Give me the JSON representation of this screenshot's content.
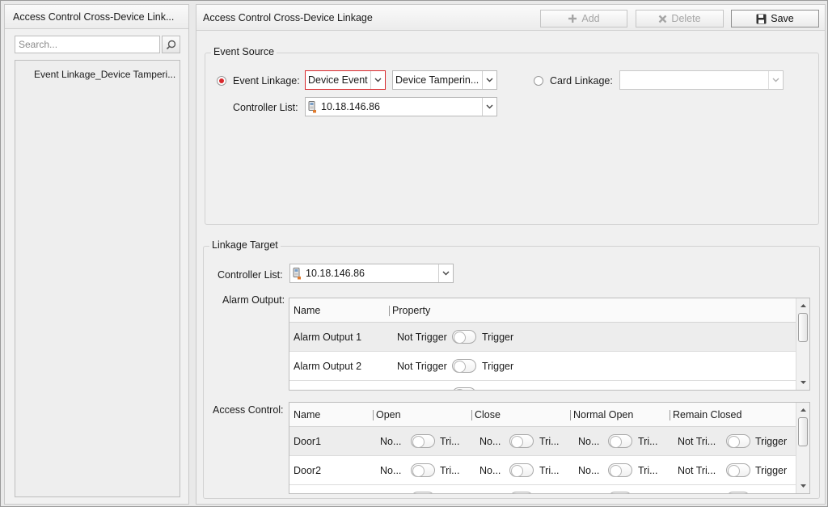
{
  "left_panel": {
    "title": "Access Control Cross-Device Link...",
    "search": {
      "placeholder": "Search...",
      "value": ""
    },
    "tree_items": [
      {
        "label": "Event Linkage_Device Tamperi..."
      }
    ]
  },
  "right_panel": {
    "title": "Access Control Cross-Device Linkage",
    "toolbar": {
      "add_label": "Add",
      "delete_label": "Delete",
      "save_label": "Save"
    },
    "event_source": {
      "title": "Event Source",
      "event_linkage_label": "Event Linkage:",
      "event_type_value": "Device Event",
      "event_value": "Device Tamperin...",
      "card_linkage_label": "Card Linkage:",
      "card_linkage_value": "",
      "controller_list_label": "Controller List:",
      "controller_value": "10.18.146.86"
    },
    "linkage_target": {
      "title": "Linkage Target",
      "controller_list_label": "Controller List:",
      "controller_value": "10.18.146.86",
      "alarm_output": {
        "label": "Alarm Output:",
        "columns": [
          "Name",
          "Property"
        ],
        "rows": [
          {
            "name": "Alarm Output 1",
            "off": "Not Trigger",
            "on": "Trigger"
          },
          {
            "name": "Alarm Output 2",
            "off": "Not Trigger",
            "on": "Trigger"
          }
        ]
      },
      "access_control": {
        "label": "Access Control:",
        "columns": [
          "Name",
          "Open",
          "Close",
          "Normal Open",
          "Remain Closed"
        ],
        "rows": [
          {
            "name": "Door1",
            "open_off": "No...",
            "open_on": "Tri...",
            "close_off": "No...",
            "close_on": "Tri...",
            "nopen_off": "No...",
            "nopen_on": "Tri...",
            "rclosed_off": "Not Tri...",
            "rclosed_on": "Trigger"
          },
          {
            "name": "Door2",
            "open_off": "No...",
            "open_on": "Tri...",
            "close_off": "No...",
            "close_on": "Tri...",
            "nopen_off": "No...",
            "nopen_on": "Tri...",
            "rclosed_off": "Not Tri...",
            "rclosed_on": "Trigger"
          }
        ]
      }
    }
  },
  "colors": {
    "accent": "#d8282c",
    "border": "#bdbdbd"
  }
}
